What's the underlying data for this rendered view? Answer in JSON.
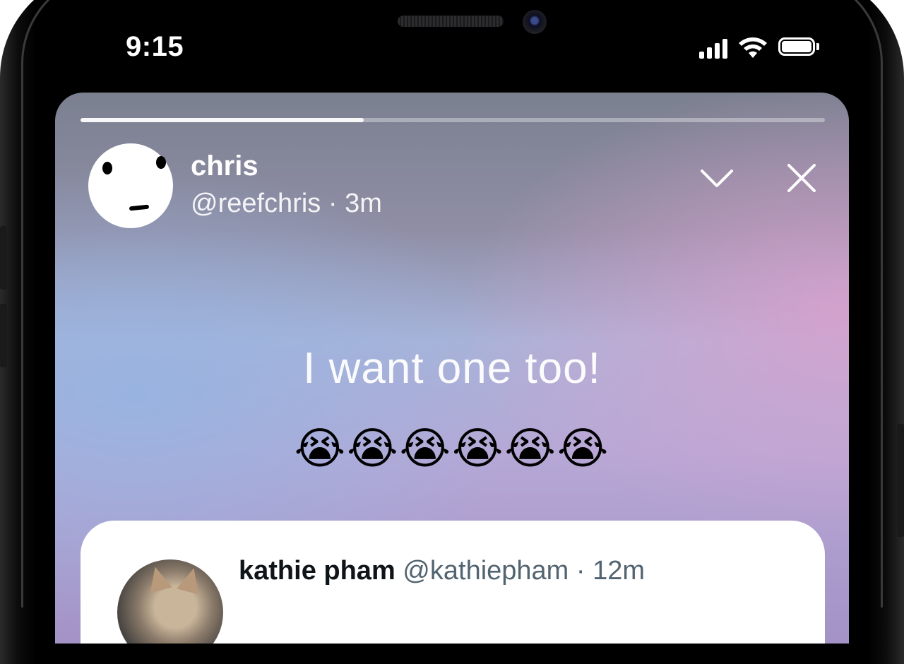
{
  "status_bar": {
    "time": "9:15",
    "signal_icon": "cellular-signal-icon",
    "wifi_icon": "wifi-icon",
    "battery_icon": "battery-icon"
  },
  "story": {
    "progress": 0.38,
    "author": {
      "name": "chris",
      "handle": "@reefchris",
      "separator": "·",
      "age": "3m"
    },
    "collapse_icon": "chevron-down-icon",
    "close_icon": "close-icon",
    "text": "I want one too!",
    "emojis": "😭😭😭😭😭😭"
  },
  "quoted_tweet": {
    "name": "kathie pham",
    "handle": "@kathiepham",
    "separator": "·",
    "age": "12m",
    "body": ""
  },
  "colors": {
    "background_top": "#7b8090",
    "background_mid": "#a9b3d8",
    "background_pink": "#dca0cd",
    "text_primary": "#ffffff",
    "quoted_name": "#0f1419",
    "quoted_meta": "#536471"
  }
}
